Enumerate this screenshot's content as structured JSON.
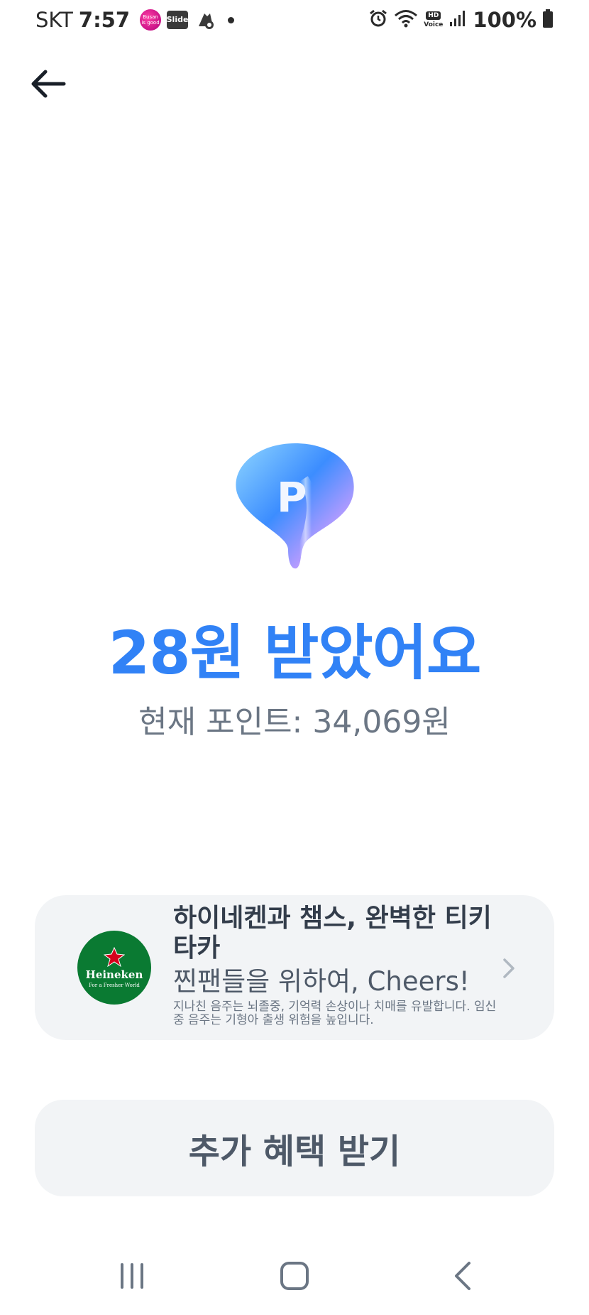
{
  "status_bar": {
    "carrier": "SKT",
    "time": "7:57",
    "apps": [
      {
        "name": "busan-is-good-app",
        "label": "Busan is good"
      },
      {
        "name": "slide-app",
        "label": "Slide"
      },
      {
        "name": "rider-app",
        "label": ""
      }
    ],
    "hd_label": "HD",
    "voice_label": "Voice",
    "battery": "100%"
  },
  "header": {
    "back_icon": "arrow-left-icon"
  },
  "reward": {
    "icon": "point-balloon-icon",
    "icon_letter": "P",
    "title": "28원 받았어요",
    "current_points": "현재 포인트: 34,069원",
    "accent_color": "#3182f6"
  },
  "ad": {
    "logo_brand": "Heineken",
    "logo_tagline": "For a Fresher World",
    "headline": "하이네켄과 챔스, 완벽한 티키타카",
    "subtitle": "찐팬들을 위하여, Cheers!",
    "warning": "지나친 음주는 뇌졸중, 기억력 손상이나 치매를 유발합니다. 임신 중 음주는 기형아 출생 위험을 높입니다."
  },
  "cta": {
    "label": "추가 혜택 받기"
  },
  "nav_bar": {
    "recent_icon": "recent-apps-icon",
    "home_icon": "home-icon",
    "back_icon": "back-icon"
  }
}
